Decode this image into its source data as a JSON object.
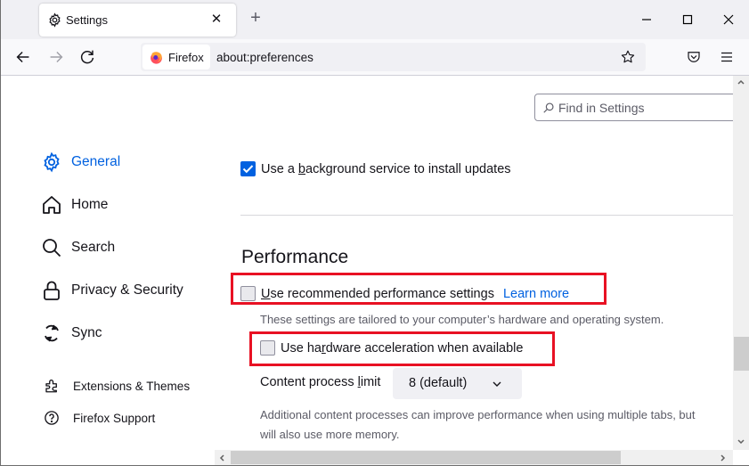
{
  "tab": {
    "title": "Settings",
    "close_glyph": "✕",
    "icon": "gear-icon"
  },
  "new_tab_glyph": "+",
  "navbar": {
    "identity_label": "Firefox",
    "url": "about:preferences"
  },
  "search": {
    "placeholder": "Find in Settings",
    "value": ""
  },
  "sidebar": {
    "items": [
      {
        "label": "General",
        "icon": "gear-icon",
        "active": true
      },
      {
        "label": "Home",
        "icon": "home-icon",
        "active": false
      },
      {
        "label": "Search",
        "icon": "search-icon",
        "active": false
      },
      {
        "label": "Privacy & Security",
        "icon": "lock-icon",
        "active": false
      },
      {
        "label": "Sync",
        "icon": "sync-icon",
        "active": false
      }
    ],
    "footer_items": [
      {
        "label": "Extensions & Themes",
        "icon": "puzzle-icon"
      },
      {
        "label": "Firefox Support",
        "icon": "help-icon"
      }
    ]
  },
  "main": {
    "background_service": {
      "label_pre": "Use a ",
      "label_accel": "b",
      "label_post": "ackground service to install updates",
      "checked": true
    },
    "performance": {
      "title": "Performance",
      "recommended": {
        "label_accel": "U",
        "label_post": "se recommended performance settings",
        "checked": false,
        "learn_more": "Learn more"
      },
      "recommended_desc": "These settings are tailored to your computer’s hardware and operating system.",
      "hardware_accel": {
        "label_pre": "Use ha",
        "label_accel": "r",
        "label_post": "dware acceleration when available",
        "checked": false
      },
      "process_limit": {
        "label_pre": "Content process ",
        "label_accel": "l",
        "label_post": "imit",
        "value": "8 (default)"
      },
      "process_desc_line1": "Additional content processes can improve performance when using multiple tabs, but",
      "process_desc_line2": "will also use more memory."
    }
  },
  "colors": {
    "accent": "#0061e0",
    "highlight": "#e81123"
  }
}
